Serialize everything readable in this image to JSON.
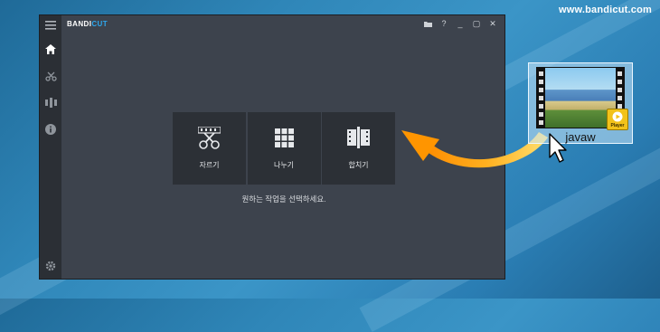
{
  "watermark": "www.bandicut.com",
  "app": {
    "logo_prefix": "BANDI",
    "logo_suffix": "CUT",
    "accent": "#2ea8ef"
  },
  "titlebar": {
    "folder": "▰",
    "help": "?",
    "minimize": "_",
    "maximize": "▢",
    "close": "✕"
  },
  "sidebar": {
    "items": [
      "menu-icon",
      "home-icon",
      "cut-icon",
      "split-icon",
      "info-icon"
    ],
    "settings": "gear-icon"
  },
  "actions": [
    {
      "label": "자르기"
    },
    {
      "label": "나누기"
    },
    {
      "label": "합치기"
    }
  ],
  "prompt": "원하는 작업을 선택하세요.",
  "desktop_file": {
    "name": "javaw",
    "badge": "Player"
  }
}
